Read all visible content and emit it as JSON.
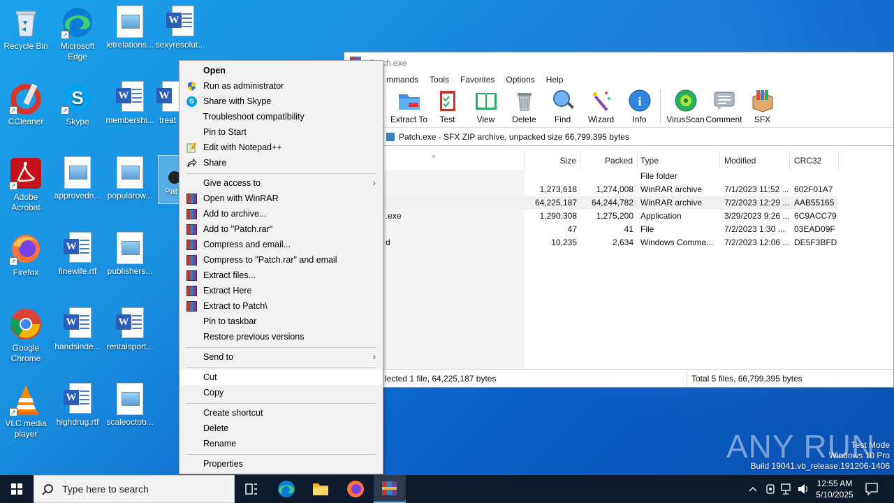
{
  "desktop": {
    "icons": [
      {
        "label": "Recycle Bin"
      },
      {
        "label": "Microsoft Edge"
      },
      {
        "label": "letrelations..."
      },
      {
        "label": "sexyresolut..."
      },
      {
        "label": "CCleaner"
      },
      {
        "label": "Skype"
      },
      {
        "label": "membershi..."
      },
      {
        "label": "treat"
      },
      {
        "label": "Adobe Acrobat"
      },
      {
        "label": "approvedn..."
      },
      {
        "label": "popularow..."
      },
      {
        "label": "Pat"
      },
      {
        "label": "Firefox"
      },
      {
        "label": "finewife.rtf"
      },
      {
        "label": "publishers..."
      },
      {
        "label": "Google Chrome"
      },
      {
        "label": "handsinde..."
      },
      {
        "label": "rentalsport..."
      },
      {
        "label": "VLC media player"
      },
      {
        "label": "highdrug.rtf"
      },
      {
        "label": "scaleoctob..."
      }
    ]
  },
  "winrar": {
    "title": "Patch.exe",
    "menu": [
      "mmands",
      "Tools",
      "Favorites",
      "Options",
      "Help"
    ],
    "toolbar": [
      "Extract To",
      "Test",
      "View",
      "Delete",
      "Find",
      "Wizard",
      "Info",
      "VirusScan",
      "Comment",
      "SFX"
    ],
    "path": "Patch.exe - SFX ZIP archive, unpacked size 66,799,395 bytes",
    "columns": [
      "Size",
      "Packed",
      "Type",
      "Modified",
      "CRC32"
    ],
    "rows": [
      {
        "name": "",
        "size": "",
        "packed": "",
        "type": "File folder",
        "modified": "",
        "crc": ""
      },
      {
        "name": "",
        "size": "1,273,618",
        "packed": "1,274,008",
        "type": "WinRAR archive",
        "modified": "7/1/2023 11:52 ...",
        "crc": "602F01A7"
      },
      {
        "name": "",
        "size": "64,225,187",
        "packed": "64,244,782",
        "type": "WinRAR archive",
        "modified": "7/2/2023 12:29 ...",
        "crc": "AAB55165"
      },
      {
        "name": ".exe",
        "size": "1,290,308",
        "packed": "1,275,200",
        "type": "Application",
        "modified": "3/29/2023 9:26 ...",
        "crc": "6C9ACC79"
      },
      {
        "name": "",
        "size": "47",
        "packed": "41",
        "type": "File",
        "modified": "7/2/2023 1:30 ...",
        "crc": "03EAD09F"
      },
      {
        "name": "d",
        "size": "10,235",
        "packed": "2,634",
        "type": "Windows Comma...",
        "modified": "7/2/2023 12:06 ...",
        "crc": "DE5F3BFD"
      }
    ],
    "status_left": "lected 1 file, 64,225,187 bytes",
    "status_right": "Total 5 files, 66,799,395 bytes"
  },
  "context_menu": {
    "items": [
      "Open",
      "Run as administrator",
      "Share with Skype",
      "Troubleshoot compatibility",
      "Pin to Start",
      "Edit with Notepad++",
      "Share",
      "Give access to",
      "Open with WinRAR",
      "Add to archive...",
      "Add to \"Patch.rar\"",
      "Compress and email...",
      "Compress to \"Patch.rar\" and email",
      "Extract files...",
      "Extract Here",
      "Extract to Patch\\",
      "Pin to taskbar",
      "Restore previous versions",
      "Send to",
      "Cut",
      "Copy",
      "Create shortcut",
      "Delete",
      "Rename",
      "Properties"
    ]
  },
  "watermark": {
    "brand": "ANY RUN",
    "line1": "Test Mode",
    "line2": "Windows 10 Pro",
    "line3": "Build 19041.vb_release.191206-1406"
  },
  "taskbar": {
    "search_placeholder": "Type here to search",
    "time": "12:55 AM",
    "date": "5/10/2025"
  }
}
